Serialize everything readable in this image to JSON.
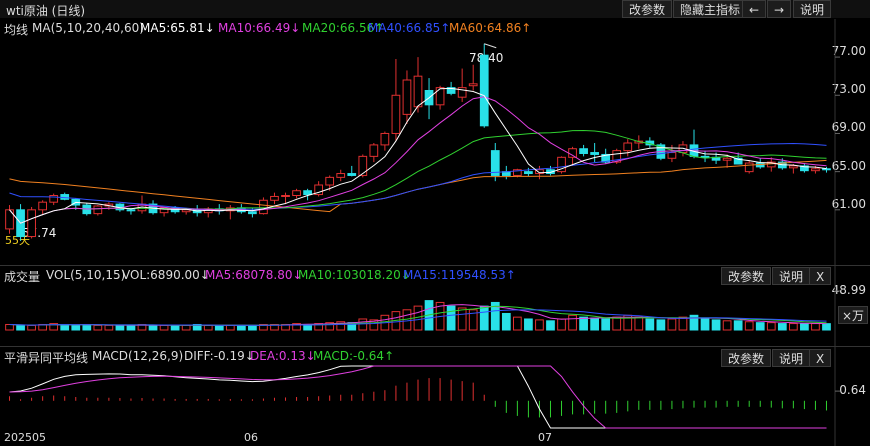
{
  "title": "wti原油 (日线)",
  "title_buttons": [
    "改参数",
    "隐藏主指标",
    "←",
    "→",
    "说明"
  ],
  "main": {
    "label": "均线",
    "ma_params": "MA(5,10,20,40,60)",
    "ma5": "MA5:65.81↓",
    "ma10": "MA10:66.49↓",
    "ma20": "MA20:66.56↑",
    "ma40": "MA40:66.85↑",
    "ma60": "MA60:64.86↑",
    "y_ticks": [
      "77.00",
      "73.00",
      "69.00",
      "65.00",
      "61.00"
    ],
    "high_label": "78.40",
    "low_label": "57.74",
    "extra_label": "55天"
  },
  "vol": {
    "label": "成交量",
    "params": "VOL(5,10,15)",
    "vol": "VOL:6890.00↓",
    "ma5": "MA5:68078.80↓",
    "ma10": "MA10:103018.20↓",
    "ma15": "MA15:119548.53↑",
    "y_tick": "48.99",
    "unit": "×万",
    "buttons": [
      "改参数",
      "说明",
      "X"
    ]
  },
  "macd": {
    "label": "平滑异同平均线",
    "params": "MACD(12,26,9)",
    "diff": "DIFF:-0.19↓",
    "dea": "DEA:0.13↓",
    "macd": "MACD:-0.64↑",
    "y_tick": "0.64",
    "buttons": [
      "改参数",
      "说明",
      "X"
    ]
  },
  "x_ticks": [
    "202505",
    "06",
    "07"
  ],
  "colors": {
    "up": "#e03030",
    "down": "#29e0e8",
    "ma5": "#ffffff",
    "ma10": "#e040e0",
    "ma20": "#30d030",
    "ma40": "#3050ff",
    "ma60": "#f08020"
  },
  "chart_data": {
    "type": "candlestick",
    "ylim": [
      57,
      79
    ],
    "candles": [
      [
        59.0,
        61.5,
        58.5,
        61.0
      ],
      [
        61.0,
        61.6,
        57.74,
        58.2
      ],
      [
        58.2,
        61.3,
        58.0,
        61.0
      ],
      [
        61.0,
        62.0,
        60.5,
        61.8
      ],
      [
        61.8,
        62.7,
        61.5,
        62.5
      ],
      [
        62.6,
        62.8,
        62.0,
        62.1
      ],
      [
        62.1,
        62.2,
        61.0,
        61.5
      ],
      [
        61.5,
        61.7,
        60.4,
        60.6
      ],
      [
        60.6,
        61.5,
        60.4,
        61.4
      ],
      [
        61.4,
        61.8,
        61.0,
        61.6
      ],
      [
        61.6,
        61.7,
        60.8,
        61.0
      ],
      [
        61.0,
        61.2,
        60.5,
        60.9
      ],
      [
        60.9,
        62.5,
        60.6,
        61.6
      ],
      [
        61.6,
        62.0,
        60.5,
        60.7
      ],
      [
        60.7,
        61.3,
        60.3,
        61.2
      ],
      [
        61.2,
        61.4,
        60.6,
        60.8
      ],
      [
        60.8,
        61.2,
        60.5,
        61.0
      ],
      [
        61.0,
        61.5,
        60.3,
        60.7
      ],
      [
        60.7,
        61.3,
        60.2,
        61.1
      ],
      [
        61.1,
        61.6,
        60.5,
        60.9
      ],
      [
        60.9,
        61.5,
        60.0,
        61.2
      ],
      [
        61.2,
        61.6,
        60.6,
        60.8
      ],
      [
        60.8,
        61.2,
        60.2,
        60.6
      ],
      [
        60.6,
        62.3,
        60.5,
        62.0
      ],
      [
        62.0,
        62.8,
        61.6,
        62.4
      ],
      [
        62.4,
        62.8,
        61.6,
        62.5
      ],
      [
        62.5,
        63.2,
        62.2,
        63.0
      ],
      [
        63.0,
        63.2,
        62.0,
        62.6
      ],
      [
        62.6,
        64.0,
        62.4,
        63.6
      ],
      [
        63.6,
        64.6,
        63.0,
        64.4
      ],
      [
        64.4,
        65.2,
        64.0,
        64.8
      ],
      [
        64.8,
        65.6,
        64.5,
        64.6
      ],
      [
        64.6,
        66.8,
        64.4,
        66.6
      ],
      [
        66.6,
        68.0,
        66.0,
        67.8
      ],
      [
        67.8,
        69.2,
        67.2,
        69.0
      ],
      [
        69.0,
        76.8,
        68.2,
        73.0
      ],
      [
        71.0,
        75.6,
        70.0,
        74.6
      ],
      [
        71.8,
        77.0,
        71.2,
        75.0
      ],
      [
        73.5,
        74.8,
        70.5,
        72.0
      ],
      [
        72.0,
        74.0,
        71.5,
        73.8
      ],
      [
        73.8,
        74.4,
        73.0,
        73.2
      ],
      [
        72.8,
        75.8,
        72.3,
        73.8
      ],
      [
        74.0,
        76.2,
        73.5,
        74.2
      ],
      [
        77.2,
        78.4,
        69.6,
        69.8
      ],
      [
        67.2,
        68.0,
        64.0,
        64.6
      ],
      [
        65.0,
        65.6,
        64.2,
        64.6
      ],
      [
        64.6,
        65.3,
        64.4,
        65.2
      ],
      [
        65.0,
        65.4,
        64.5,
        64.8
      ],
      [
        64.8,
        65.6,
        64.2,
        65.2
      ],
      [
        65.2,
        65.6,
        64.6,
        64.8
      ],
      [
        65.0,
        66.6,
        64.8,
        66.5
      ],
      [
        66.5,
        67.6,
        65.6,
        67.4
      ],
      [
        67.4,
        67.8,
        66.6,
        66.9
      ],
      [
        67.0,
        68.0,
        66.0,
        66.8
      ],
      [
        66.8,
        67.4,
        65.8,
        66.0
      ],
      [
        66.0,
        67.4,
        65.8,
        67.2
      ],
      [
        67.2,
        68.4,
        66.6,
        68.0
      ],
      [
        68.0,
        68.8,
        67.4,
        68.2
      ],
      [
        68.2,
        68.6,
        67.5,
        67.8
      ],
      [
        67.8,
        68.0,
        66.2,
        66.4
      ],
      [
        66.4,
        67.8,
        66.0,
        67.0
      ],
      [
        67.0,
        68.2,
        66.6,
        67.8
      ],
      [
        67.8,
        69.4,
        66.4,
        66.6
      ],
      [
        66.6,
        67.2,
        66.0,
        66.5
      ],
      [
        66.5,
        67.0,
        65.8,
        66.2
      ],
      [
        66.2,
        66.8,
        65.4,
        66.4
      ],
      [
        66.4,
        67.0,
        65.8,
        65.8
      ],
      [
        65.0,
        66.2,
        64.8,
        65.9
      ],
      [
        65.9,
        66.4,
        65.3,
        65.5
      ],
      [
        65.5,
        66.5,
        65.0,
        66.0
      ],
      [
        66.0,
        66.4,
        65.2,
        65.4
      ],
      [
        65.4,
        65.8,
        64.8,
        65.6
      ],
      [
        65.6,
        65.9,
        64.9,
        65.1
      ],
      [
        65.1,
        65.6,
        64.8,
        65.3
      ],
      [
        65.3,
        65.5,
        64.9,
        65.2
      ]
    ],
    "volume": [
      6,
      5,
      5,
      6,
      7,
      6,
      5,
      6,
      5,
      5,
      5,
      5,
      6,
      5,
      5,
      5,
      5,
      6,
      5,
      5,
      5,
      5,
      5,
      6,
      6,
      6,
      7,
      6,
      7,
      8,
      9,
      8,
      12,
      11,
      16,
      20,
      22,
      26,
      32,
      30,
      26,
      24,
      22,
      26,
      30,
      18,
      14,
      12,
      11,
      10,
      12,
      16,
      14,
      13,
      12,
      14,
      16,
      14,
      12,
      11,
      12,
      14,
      16,
      12,
      11,
      10,
      10,
      9,
      8,
      8,
      7,
      7,
      7,
      7,
      6.9
    ],
    "vol_ylim": [
      0,
      48.99
    ],
    "macd_hist": [
      0.3,
      0.1,
      0.2,
      0.3,
      0.35,
      0.3,
      0.25,
      0.2,
      0.2,
      0.2,
      0.18,
      0.15,
      0.18,
      0.15,
      0.15,
      0.12,
      0.12,
      0.12,
      0.12,
      0.1,
      0.12,
      0.1,
      0.1,
      0.15,
      0.2,
      0.22,
      0.25,
      0.25,
      0.3,
      0.35,
      0.4,
      0.4,
      0.5,
      0.6,
      0.7,
      1.0,
      1.2,
      1.4,
      1.5,
      1.5,
      1.4,
      1.3,
      1.2,
      0.4,
      -0.4,
      -0.8,
      -1.0,
      -1.1,
      -1.1,
      -1.1,
      -1.0,
      -0.9,
      -0.9,
      -0.85,
      -0.85,
      -0.8,
      -0.7,
      -0.6,
      -0.6,
      -0.6,
      -0.55,
      -0.5,
      -0.45,
      -0.45,
      -0.45,
      -0.4,
      -0.4,
      -0.4,
      -0.4,
      -0.45,
      -0.5,
      -0.5,
      -0.55,
      -0.6,
      -0.64
    ],
    "macd_ylim": [
      -1.8,
      2.3
    ]
  }
}
